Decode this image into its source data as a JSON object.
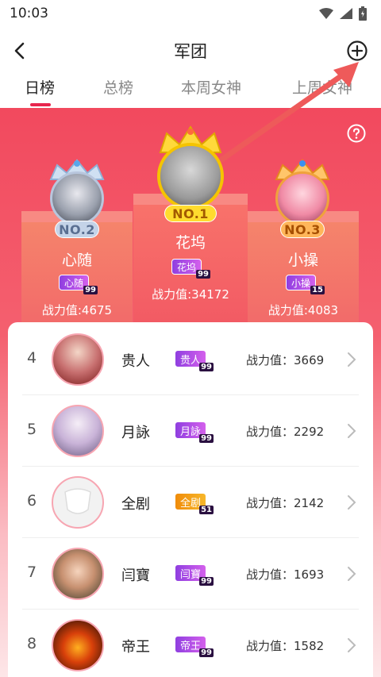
{
  "status_bar": {
    "time": "10:03"
  },
  "nav": {
    "title": "军团"
  },
  "tabs": [
    {
      "label": "日榜",
      "active": true
    },
    {
      "label": "总榜",
      "active": false
    },
    {
      "label": "本周女神",
      "active": false
    },
    {
      "label": "上周女神",
      "active": false
    }
  ],
  "top3": [
    {
      "rank_label": "NO.1",
      "name": "花坞",
      "tag": "花坞",
      "level": "99",
      "power": "战力值:34172"
    },
    {
      "rank_label": "NO.2",
      "name": "心随",
      "tag": "心随",
      "level": "99",
      "power": "战力值:4675"
    },
    {
      "rank_label": "NO.3",
      "name": "小操",
      "tag": "小操",
      "level": "15",
      "power": "战力值:4083"
    }
  ],
  "list": [
    {
      "rank": "4",
      "name": "贵人",
      "tag": "贵人",
      "level": "99",
      "power_label": "战力值：3669"
    },
    {
      "rank": "5",
      "name": "月詠",
      "tag": "月詠",
      "level": "99",
      "power_label": "战力值：2292"
    },
    {
      "rank": "6",
      "name": "全剧",
      "tag": "全剧",
      "level": "51",
      "power_label": "战力值：2142"
    },
    {
      "rank": "7",
      "name": "闫寶",
      "tag": "闫寶",
      "level": "99",
      "power_label": "战力值：1693"
    },
    {
      "rank": "8",
      "name": "帝王",
      "tag": "帝王",
      "level": "99",
      "power_label": "战力值：1582"
    }
  ],
  "colors": {
    "accent": "#e8264e",
    "banner_top": "#f2495e",
    "gold": "#f5c400",
    "silver": "#b8c6dd",
    "bronze": "#f0a23c",
    "tag_purple": "#b545e6",
    "tag_orange": "#f2a30f"
  },
  "icons": [
    "back-icon",
    "add-circle-icon",
    "help-icon",
    "chevron-right-icon",
    "wifi-icon",
    "signal-icon",
    "battery-icon",
    "crown-icon"
  ]
}
